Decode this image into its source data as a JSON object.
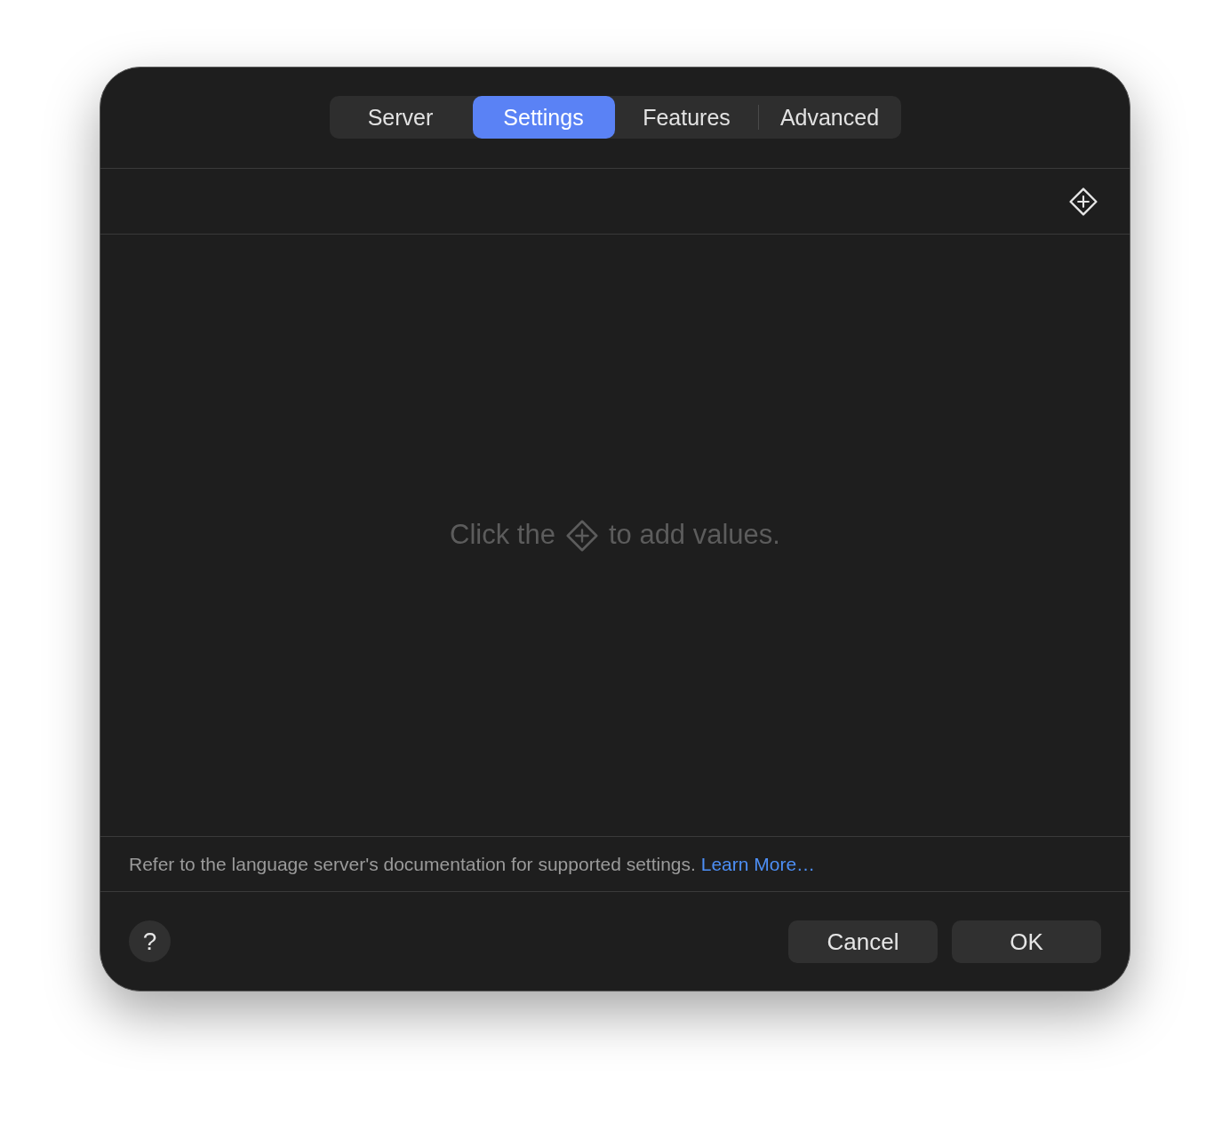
{
  "tabs": [
    {
      "label": "Server",
      "selected": false
    },
    {
      "label": "Settings",
      "selected": true
    },
    {
      "label": "Features",
      "selected": false
    },
    {
      "label": "Advanced",
      "selected": false
    }
  ],
  "empty_state": {
    "text_before": "Click the",
    "text_after": "to add values."
  },
  "footer_note": {
    "text": "Refer to the language server's documentation for supported settings.",
    "link": "Learn More…"
  },
  "help_button": {
    "label": "?"
  },
  "buttons": [
    {
      "label": "Cancel"
    },
    {
      "label": "OK"
    }
  ]
}
